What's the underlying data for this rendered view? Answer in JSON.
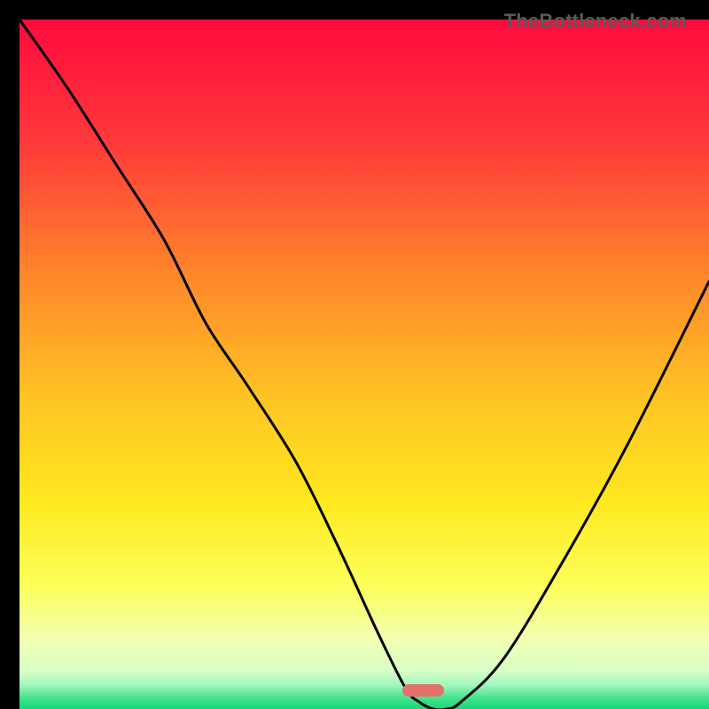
{
  "watermark": "TheBottleneck.com",
  "chart_data": {
    "type": "line",
    "title": "",
    "xlabel": "",
    "ylabel": "",
    "xlim": [
      0,
      100
    ],
    "ylim": [
      0,
      100
    ],
    "grid": false,
    "legend": false,
    "series": [
      {
        "name": "bottleneck-curve",
        "x": [
          0,
          7,
          14,
          21,
          27,
          33,
          40,
          46,
          52,
          56,
          58,
          60,
          62,
          64,
          70,
          78,
          88,
          100
        ],
        "values": [
          100,
          90,
          79,
          68,
          56,
          47,
          36,
          24,
          11,
          3,
          1,
          0,
          0,
          1,
          7,
          20,
          38,
          62
        ]
      }
    ],
    "annotations": [
      {
        "name": "optimal-marker",
        "x_center": 60,
        "width_pct": 6,
        "y": 0,
        "color": "#e2706b"
      }
    ],
    "background_gradient": {
      "stops": [
        {
          "offset": 0.0,
          "color": "#ff0a3e"
        },
        {
          "offset": 0.18,
          "color": "#ff3a3a"
        },
        {
          "offset": 0.38,
          "color": "#ff8a2a"
        },
        {
          "offset": 0.55,
          "color": "#ffc423"
        },
        {
          "offset": 0.7,
          "color": "#ffe81f"
        },
        {
          "offset": 0.82,
          "color": "#fdff59"
        },
        {
          "offset": 0.9,
          "color": "#f2ffb3"
        },
        {
          "offset": 0.945,
          "color": "#d7ffc6"
        },
        {
          "offset": 0.965,
          "color": "#a2f7bf"
        },
        {
          "offset": 0.985,
          "color": "#3fe28a"
        },
        {
          "offset": 1.0,
          "color": "#1bd67a"
        }
      ]
    }
  }
}
